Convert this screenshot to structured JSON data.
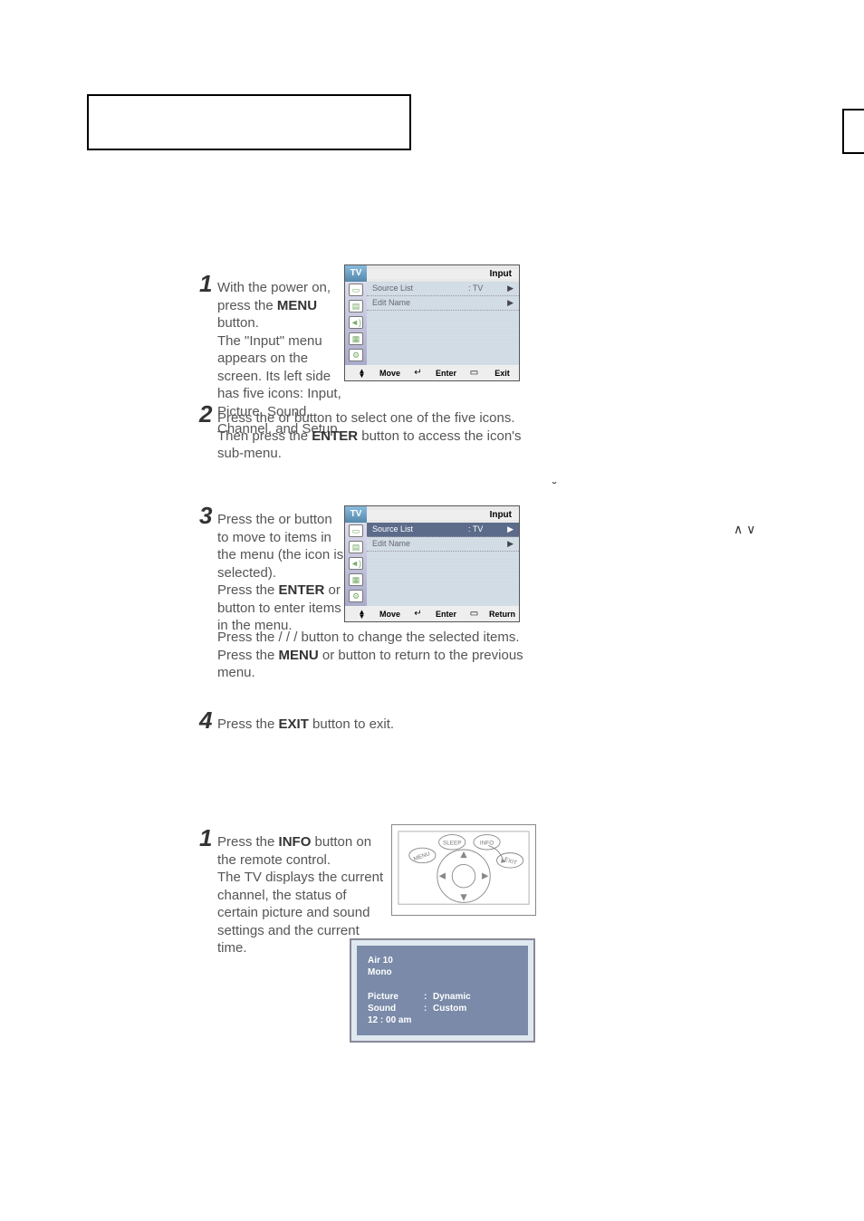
{
  "title_box": "",
  "step1": {
    "num": "1",
    "text_a": "With the power on, press the ",
    "menu_b": "MENU",
    "text_b": " button.",
    "text_c": "The \"Input\" menu appears on the screen. Its left side has five icons: Input, Picture, Sound, Channel, and Setup."
  },
  "step2": {
    "num": "2",
    "text_a": "Press the       or       button to select one of the five icons. Then press the ",
    "enter_b": "ENTER",
    "text_b": " button to access the icon's sub-menu."
  },
  "step3": {
    "num": "3",
    "text_a": "Press the      or      button to move to items in the menu (the icon is selected).",
    "text_b1": "Press the ",
    "enter_b": "ENTER",
    "text_b2": " or    button to enter items in the menu.",
    "text_c": "Press the       /      /     /     button to change the selected items.",
    "text_d1": "Press the ",
    "menu_b": "MENU",
    "text_d2": " or      button to return to the previous menu."
  },
  "step4": {
    "num": "4",
    "text_a": "Press the ",
    "exit_b": "EXIT",
    "text_b": " button to exit."
  },
  "step5": {
    "num": "1",
    "text_a": "Press the ",
    "info_b": "INFO",
    "text_b": " button on the remote control.",
    "text_c": "The TV displays the current channel, the status of certain picture and sound settings and the current time."
  },
  "osd1": {
    "tv": "TV",
    "title": "Input",
    "rows": [
      {
        "label": "Source List",
        "val": ": TV",
        "arrow": "▶"
      },
      {
        "label": "Edit Name",
        "val": "",
        "arrow": "▶"
      }
    ],
    "footer": {
      "move": "Move",
      "enter": "Enter",
      "last": "Exit"
    }
  },
  "osd2": {
    "tv": "TV",
    "title": "Input",
    "rows": [
      {
        "label": "Source List",
        "val": ": TV",
        "arrow": "▶",
        "sel": true
      },
      {
        "label": "Edit Name",
        "val": "",
        "arrow": "▶"
      }
    ],
    "footer": {
      "move": "Move",
      "enter": "Enter",
      "last": "Return"
    }
  },
  "remote": {
    "sleep": "SLEEP",
    "info": "INFO",
    "menu": "MENU",
    "exit": "EXIT"
  },
  "info_panel": {
    "ch": "Air  10",
    "snd": "Mono",
    "rows": [
      {
        "lab": "Picture",
        "val": "Dynamic"
      },
      {
        "lab": "Sound",
        "val": "Custom"
      }
    ],
    "time": "12 : 00 am"
  },
  "side_caret": "∧ ∨",
  "side_caveat_tail": "˘"
}
